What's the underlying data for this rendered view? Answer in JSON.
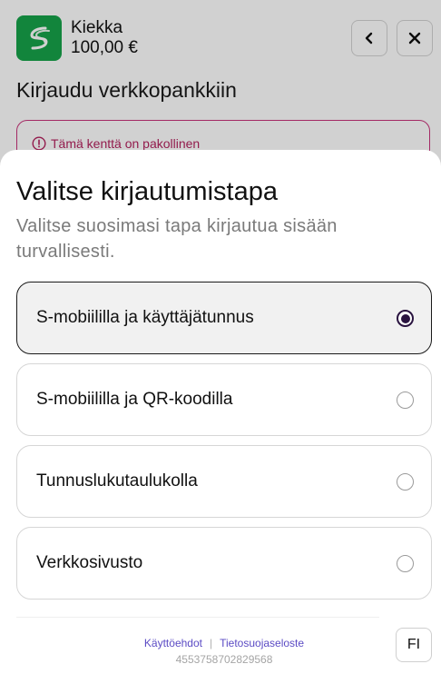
{
  "merchant": {
    "name": "Kiekka",
    "amount": "100,00 €"
  },
  "background": {
    "title": "Kirjaudu verkkopankkiin",
    "error_message": "Tämä kenttä on pakollinen"
  },
  "sheet": {
    "title": "Valitse kirjautumistapa",
    "subtitle": "Valitse suosimasi tapa kirjautua sisään turvallisesti.",
    "options": [
      {
        "label": "S-mobiililla ja käyttäjätunnus",
        "selected": true
      },
      {
        "label": "S-mobiililla ja QR-koodilla",
        "selected": false
      },
      {
        "label": "Tunnuslukutaulukolla",
        "selected": false
      },
      {
        "label": "Verkkosivusto",
        "selected": false
      }
    ]
  },
  "footer": {
    "terms_link": "Käyttöehdot",
    "separator": "|",
    "privacy_link": "Tietosuojaseloste",
    "session_id": "4553758702829568",
    "language": "FI"
  },
  "colors": {
    "brand_green": "#16a34a",
    "error": "#c8327a",
    "radio_selected": "#2a1440",
    "link": "#5b4bc4"
  },
  "icons": {
    "logo": "s-logo-icon",
    "back": "chevron-left-icon",
    "close": "close-icon",
    "error": "alert-circle-icon"
  }
}
